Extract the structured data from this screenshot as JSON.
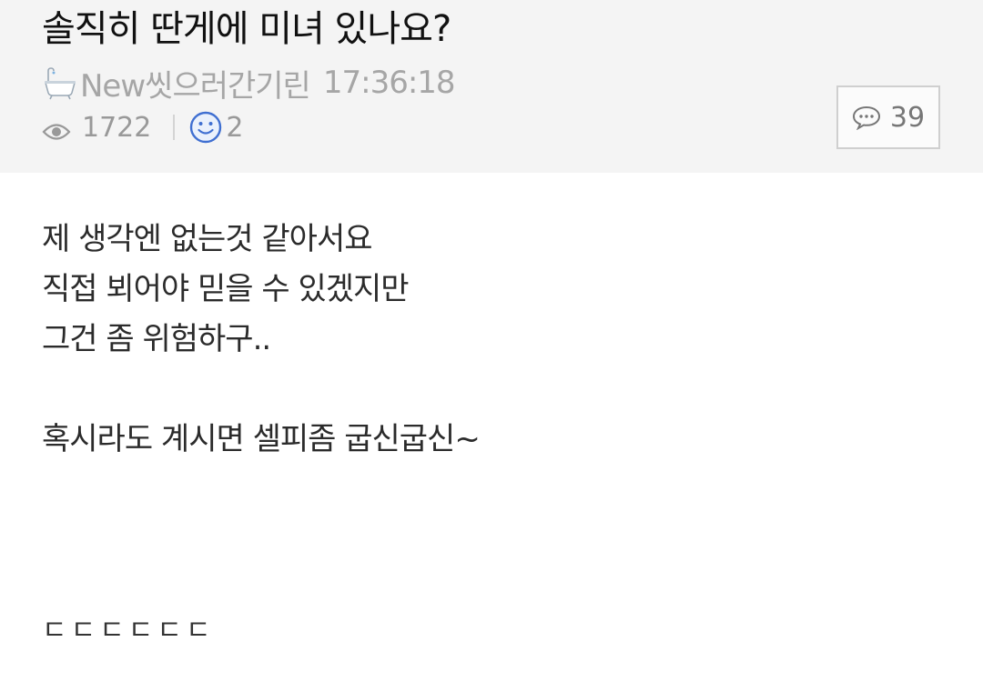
{
  "post": {
    "title": "솔직히 딴게에 미녀 있나요?",
    "author": "New씻으러간기린",
    "time": "17:36:18",
    "views": "1722",
    "likes": "2",
    "comments": "39"
  },
  "content": {
    "lines": [
      "제 생각엔 없는것 같아서요",
      "직접 뵈어야 믿을 수 있겠지만",
      "그건 좀 위험하구..",
      "혹시라도 계시면 셀피좀 굽신굽신~"
    ],
    "ending": "ㄷㄷㄷㄷㄷㄷ"
  },
  "icons": {
    "author_badge": "bathtub-icon",
    "views": "eye-icon",
    "likes": "smiley-icon",
    "comments": "speech-bubble-icon"
  },
  "colors": {
    "header_bg": "#f4f4f4",
    "smiley_blue": "#3f6fd1",
    "meta_gray": "#a6a6a6"
  }
}
